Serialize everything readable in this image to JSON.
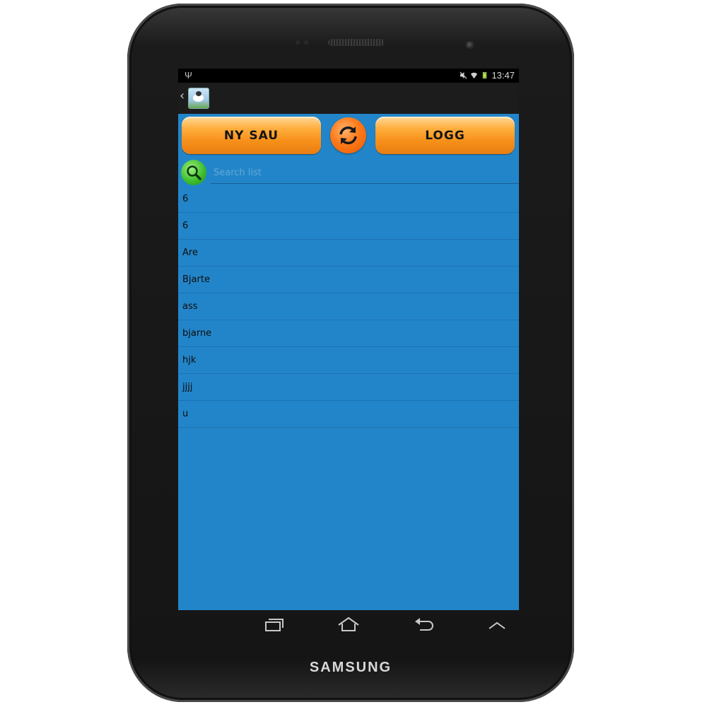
{
  "device": {
    "brand": "SAMSUNG"
  },
  "status_bar": {
    "time": "13:47"
  },
  "toolbar": {
    "new_sheep_label": "NY SAU",
    "log_label": "LOGG"
  },
  "search": {
    "placeholder": "Search list"
  },
  "list_items": [
    "6",
    "6",
    "Are",
    "Bjarte",
    "ass",
    "bjarne",
    "hjk",
    "jjjj",
    "u"
  ],
  "colors": {
    "screen_bg": "#2385c9",
    "button_orange": "#f7901a",
    "search_green": "#3fbf2e"
  },
  "icons": [
    "usb-icon",
    "mute-icon",
    "wifi-icon",
    "battery-icon",
    "back-caret-icon",
    "app-sheep-icon",
    "refresh-icon",
    "search-icon",
    "recent-apps-icon",
    "home-icon",
    "back-icon",
    "menu-up-icon"
  ]
}
